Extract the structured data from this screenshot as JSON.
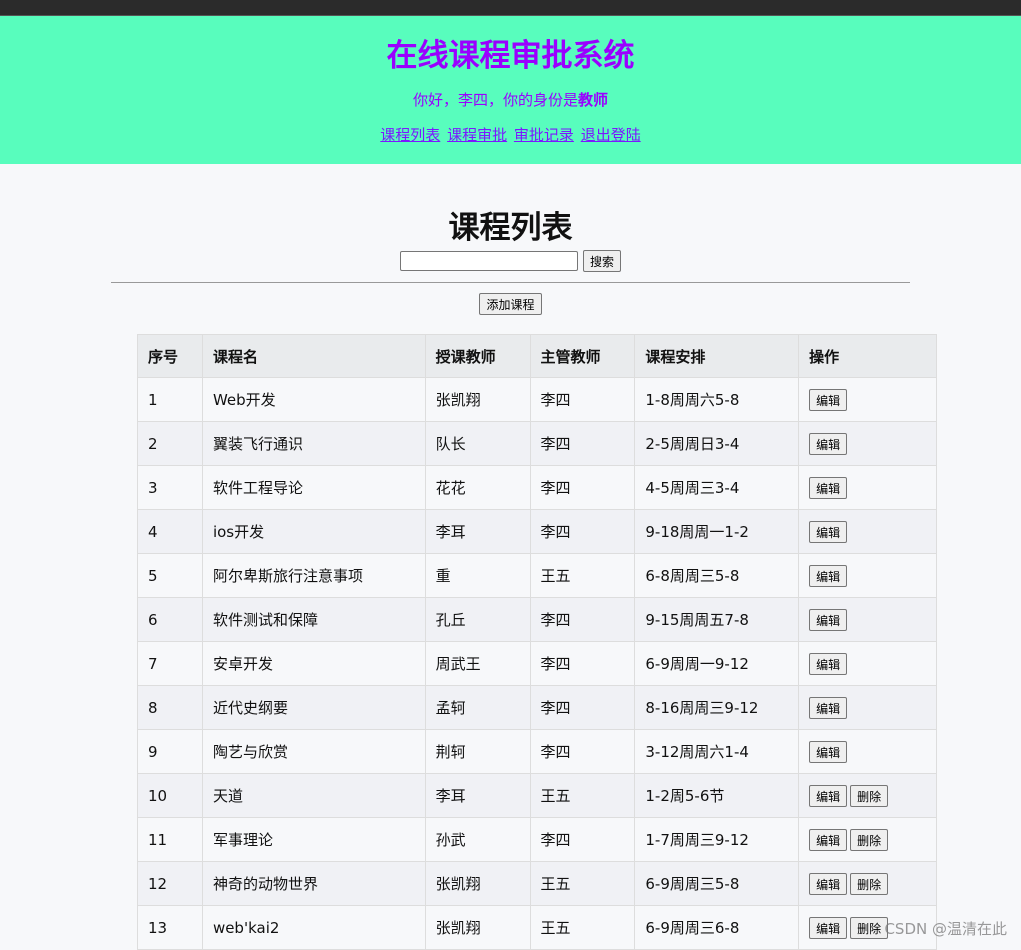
{
  "header": {
    "title": "在线课程审批系统",
    "greeting_prefix": "你好，李四，你的身份是",
    "role": "教师",
    "nav": [
      "课程列表",
      "课程审批",
      "审批记录",
      "退出登陆"
    ]
  },
  "main": {
    "title": "课程列表",
    "search_value": "",
    "search_button": "搜索",
    "add_button": "添加课程"
  },
  "table": {
    "columns": [
      "序号",
      "课程名",
      "授课教师",
      "主管教师",
      "课程安排",
      "操作"
    ],
    "edit_label": "编辑",
    "delete_label": "删除",
    "rows": [
      {
        "id": "1",
        "name": "Web开发",
        "teacher": "张凯翔",
        "supervisor": "李四",
        "schedule": "1-8周周六5-8",
        "deletable": false
      },
      {
        "id": "2",
        "name": "翼装飞行通识",
        "teacher": "队长",
        "supervisor": "李四",
        "schedule": "2-5周周日3-4",
        "deletable": false
      },
      {
        "id": "3",
        "name": "软件工程导论",
        "teacher": "花花",
        "supervisor": "李四",
        "schedule": "4-5周周三3-4",
        "deletable": false
      },
      {
        "id": "4",
        "name": "ios开发",
        "teacher": "李耳",
        "supervisor": "李四",
        "schedule": "9-18周周一1-2",
        "deletable": false
      },
      {
        "id": "5",
        "name": "阿尔卑斯旅行注意事项",
        "teacher": "重",
        "supervisor": "王五",
        "schedule": "6-8周周三5-8",
        "deletable": false
      },
      {
        "id": "6",
        "name": "软件测试和保障",
        "teacher": "孔丘",
        "supervisor": "李四",
        "schedule": "9-15周周五7-8",
        "deletable": false
      },
      {
        "id": "7",
        "name": "安卓开发",
        "teacher": "周武王",
        "supervisor": "李四",
        "schedule": "6-9周周一9-12",
        "deletable": false
      },
      {
        "id": "8",
        "name": "近代史纲要",
        "teacher": "孟轲",
        "supervisor": "李四",
        "schedule": "8-16周周三9-12",
        "deletable": false
      },
      {
        "id": "9",
        "name": "陶艺与欣赏",
        "teacher": "荆轲",
        "supervisor": "李四",
        "schedule": "3-12周周六1-4",
        "deletable": false
      },
      {
        "id": "10",
        "name": "天道",
        "teacher": "李耳",
        "supervisor": "王五",
        "schedule": "1-2周5-6节",
        "deletable": true
      },
      {
        "id": "11",
        "name": "军事理论",
        "teacher": "孙武",
        "supervisor": "李四",
        "schedule": "1-7周周三9-12",
        "deletable": true
      },
      {
        "id": "12",
        "name": "神奇的动物世界",
        "teacher": "张凯翔",
        "supervisor": "王五",
        "schedule": "6-9周周三5-8",
        "deletable": true
      },
      {
        "id": "13",
        "name": "web'kai2",
        "teacher": "张凯翔",
        "supervisor": "王五",
        "schedule": "6-9周周三6-8",
        "deletable": true
      }
    ]
  },
  "watermark": "CSDN @温清在此"
}
